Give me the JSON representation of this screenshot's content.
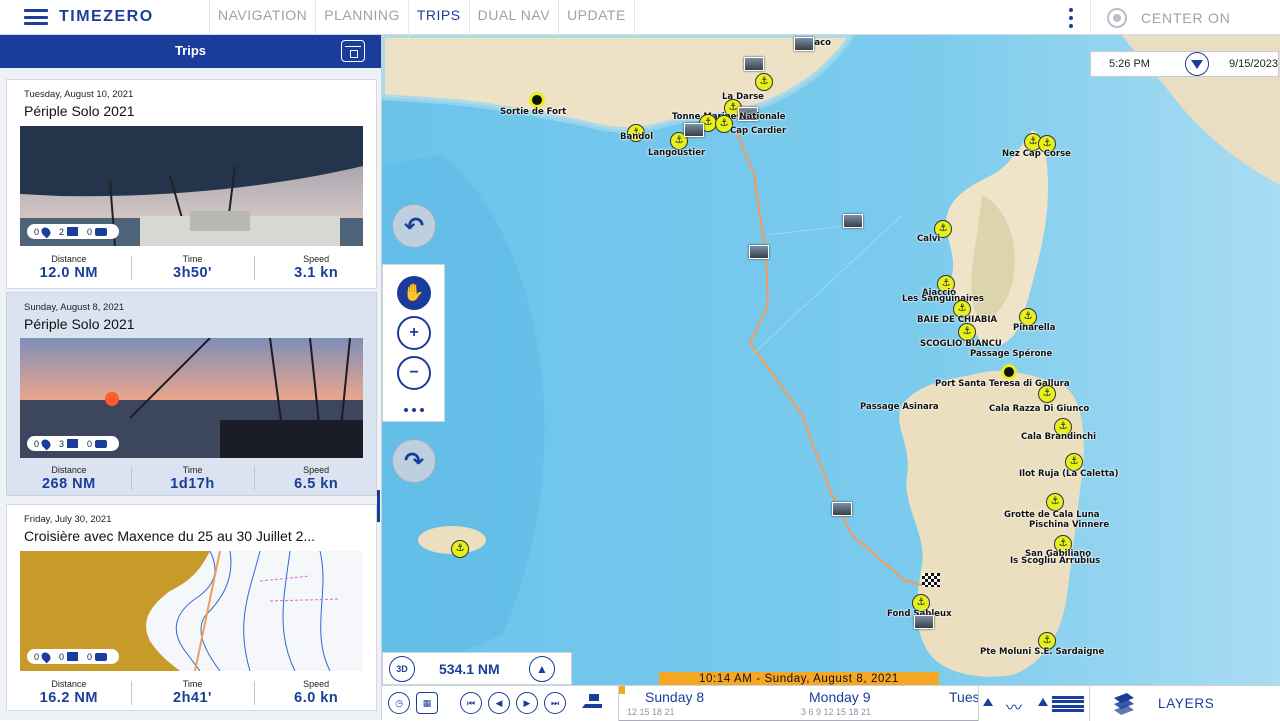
{
  "app": {
    "brand": "TIMEZERO"
  },
  "tabs": [
    {
      "label": "NAVIGATION"
    },
    {
      "label": "PLANNING"
    },
    {
      "label": "TRIPS"
    },
    {
      "label": "DUAL NAV"
    },
    {
      "label": "UPDATE"
    }
  ],
  "active_tab": "TRIPS",
  "center_on": {
    "label": "CENTER ON"
  },
  "panel": {
    "title": "Trips"
  },
  "trips": [
    {
      "date": "Tuesday, August 10, 2021",
      "title": "Périple Solo 2021",
      "waypoints": "0",
      "photos": "2",
      "videos": "0",
      "distance_label": "Distance",
      "distance": "12.0 NM",
      "time_label": "Time",
      "time": "3h50'",
      "speed_label": "Speed",
      "speed": "3.1 kn"
    },
    {
      "date": "Sunday, August 8, 2021",
      "title": "Périple Solo 2021",
      "waypoints": "0",
      "photos": "3",
      "videos": "0",
      "distance_label": "Distance",
      "distance": "268 NM",
      "time_label": "Time",
      "time": "1d17h",
      "speed_label": "Speed",
      "speed": "6.5 kn"
    },
    {
      "date": "Friday, July 30, 2021",
      "title": "Croisière avec Maxence du 25 au 30 Juillet 2...",
      "waypoints": "0",
      "photos": "0",
      "videos": "0",
      "distance_label": "Distance",
      "distance": "16.2 NM",
      "time_label": "Time",
      "time": "2h41'",
      "speed_label": "Speed",
      "speed": "6.0 kn"
    }
  ],
  "map": {
    "clock": {
      "time": "5:26 PM",
      "date": "9/15/2023"
    },
    "distance": "534.1 NM",
    "btn_3d": "3D",
    "time_banner": "10:14 AM - Sunday, August 8, 2021",
    "labels": {
      "monaco": "Monaco",
      "sortie_de_fort": "Sortie de Fort",
      "la_darse": "La Darse",
      "tonne_nationale": "Tonne Marine Nationale",
      "bandol": "Bandol",
      "langoustier": "Langoustier",
      "cap_cardier": "Cap Cardier",
      "nez_cap_corse": "Nez Cap Corse",
      "calvi": "Calvi",
      "les_sanguinaires": "Les Sanguinaires",
      "ajaccio": "Ajaccio",
      "baie_de_chiabia": "BAIE DE CHIABIA",
      "pinarella": "Pinarella",
      "scoglio_bianco": "SCOGLIO BIANCU",
      "passage_sperone": "Passage Spérone",
      "port_santa_teresa": "Port Santa Teresa di Gallura",
      "passage_asinara": "Passage Asinara",
      "cala_razza": "Cala Razza Di Giunco",
      "cala_brandinchi": "Cala Brandinchi",
      "ilot_ruja": "Ilot Ruja (La Caletta)",
      "grotte_luna": "Grotte de Cala Luna",
      "pischina": "Pischina Vinnere",
      "san_gavino": "San Gabiliano",
      "is_scogliu": "Is Scogliu Arrubius",
      "fond_sableux": "Fond Sableux",
      "pte_sardaigne": "Pte Moluni S.E. Sardaigne"
    }
  },
  "timeline": {
    "days": [
      {
        "label": "Sunday 8",
        "hours": "12  15  18  21"
      },
      {
        "label": "Monday 9",
        "hours": "3  6  9  12  15  18  21"
      },
      {
        "label": "Tues"
      }
    ]
  },
  "bottom": {
    "layers_label": "LAYERS"
  },
  "colors": {
    "brand_blue": "#1a3d9b",
    "accent_orange": "#f5a623",
    "anchor_yellow": "#e6f01c",
    "sea": "#6fc3e8"
  }
}
